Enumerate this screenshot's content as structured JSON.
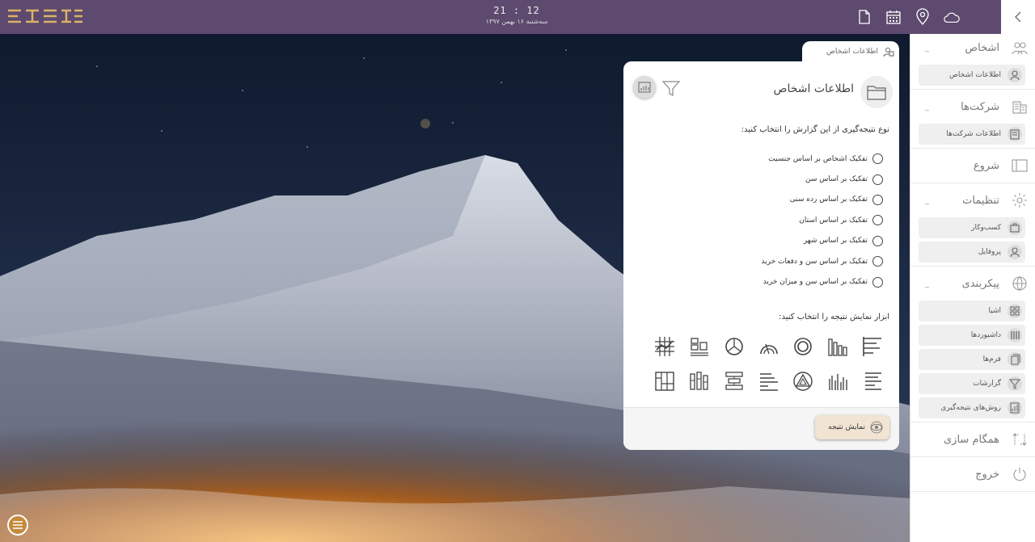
{
  "brand": {
    "logo_name": "app-logo"
  },
  "clock": {
    "time": "21 : 12",
    "date": "سه‌شنبه ۱۶ بهمن ۱۳۹۷"
  },
  "panel": {
    "tab_label": "اطلاعات اشخاص",
    "title": "اطلاعات اشخاص",
    "question_type": "نوع نتیجه‌گیری از این گزارش را انتخاب کنید:",
    "options": [
      "تفکیک اشخاص بر اساس جنسیت",
      "تفکیک بر اساس سن",
      "تفکیک بر اساس رده سنی",
      "تفکیک بر اساس استان",
      "تفکیک بر اساس شهر",
      "تفکیک بر اساس سن و دفعات خرید",
      "تفکیک بر اساس سن و میزان خرید"
    ],
    "question_tools": "ابزار نمایش نتیجه را انتخاب کنید:",
    "show_button": "نمایش نتیجه"
  },
  "sidebar": {
    "persons": {
      "label": "اشخاص",
      "items": [
        "اطلاعات اشخاص"
      ]
    },
    "companies": {
      "label": "شرکت‌ها",
      "items": [
        "اطلاعات شرکت‌ها"
      ]
    },
    "start": {
      "label": "شروع"
    },
    "settings": {
      "label": "تنظیمات",
      "items": [
        "کسب‌وکار",
        "پروفایل"
      ]
    },
    "config": {
      "label": "پیکربندی",
      "items": [
        "اشیا",
        "داشبوردها",
        "فرم‌ها",
        "گزارشات",
        "روش‌های نتیجه‌گیری"
      ]
    },
    "sync": {
      "label": "همگام سازی"
    },
    "exit": {
      "label": "خروج"
    }
  },
  "colors": {
    "topbar": "#5d4a6e",
    "accent": "#c58a3a",
    "button_bg": "#f1e4d3"
  }
}
